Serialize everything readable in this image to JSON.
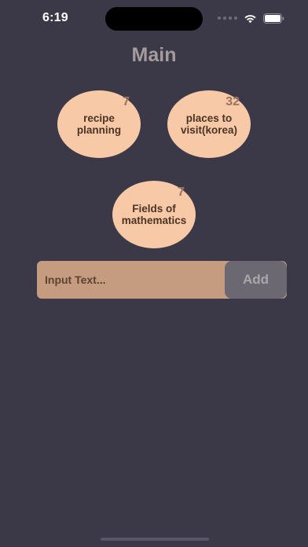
{
  "status_bar": {
    "time": "6:19",
    "icons": [
      "cellular-signal-icon",
      "wifi-icon",
      "battery-icon"
    ]
  },
  "header": {
    "title": "Main"
  },
  "lists": [
    {
      "label_line1": "recipe",
      "label_line2": "planning",
      "count": "7"
    },
    {
      "label_line1": "places to",
      "label_line2": "visit(korea)",
      "count": "32"
    },
    {
      "label_line1": "Fields of",
      "label_line2": "mathematics",
      "count": "7"
    }
  ],
  "input": {
    "placeholder": "Input Text...",
    "value": ""
  },
  "add_button": {
    "label": "Add"
  },
  "colors": {
    "background": "#3b3947",
    "circle": "#f8c9a6",
    "input": "#c59c7f",
    "button": "#6b6872",
    "title": "#a59b9d"
  }
}
